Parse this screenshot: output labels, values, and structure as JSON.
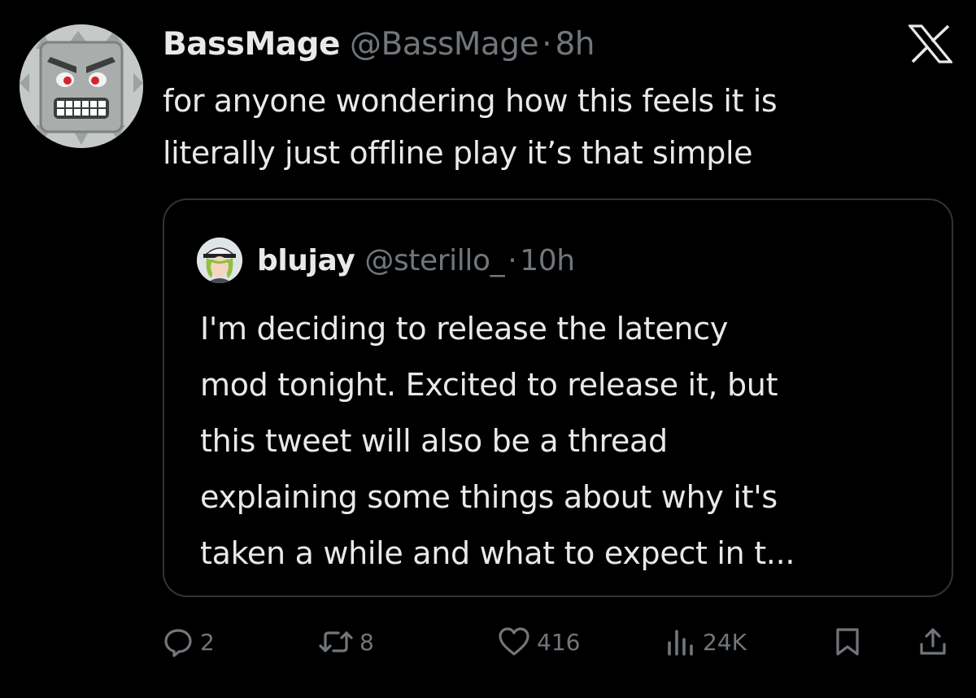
{
  "tweet": {
    "display_name": "BassMage",
    "handle": "@BassMage",
    "separator": "·",
    "time": "8h",
    "text_line1": "for anyone wondering how this feels it is",
    "text_line2": "literally just offline play it’s that simple",
    "avatar_icon": "thwomp-avatar"
  },
  "quote": {
    "display_name": "blujay",
    "handle": "@sterillo_",
    "separator": "·",
    "time": "10h",
    "avatar_icon": "anime-character-avatar",
    "lines": [
      "I'm deciding to release the latency",
      "mod tonight. Excited to release it, but",
      "this tweet will also be a thread",
      "explaining some things about why it's",
      "taken a while and what to expect in t..."
    ]
  },
  "actions": {
    "replies": "2",
    "reposts": "8",
    "likes": "416",
    "views": "24K"
  },
  "icons": {
    "brand": "x-logo",
    "reply": "reply-icon",
    "repost": "repost-icon",
    "like": "heart-icon",
    "views": "views-icon",
    "bookmark": "bookmark-icon",
    "share": "share-icon"
  },
  "colors": {
    "background": "#000000",
    "primary_text": "#e7e9ea",
    "secondary_text": "#71767b",
    "border": "#2f3336"
  }
}
